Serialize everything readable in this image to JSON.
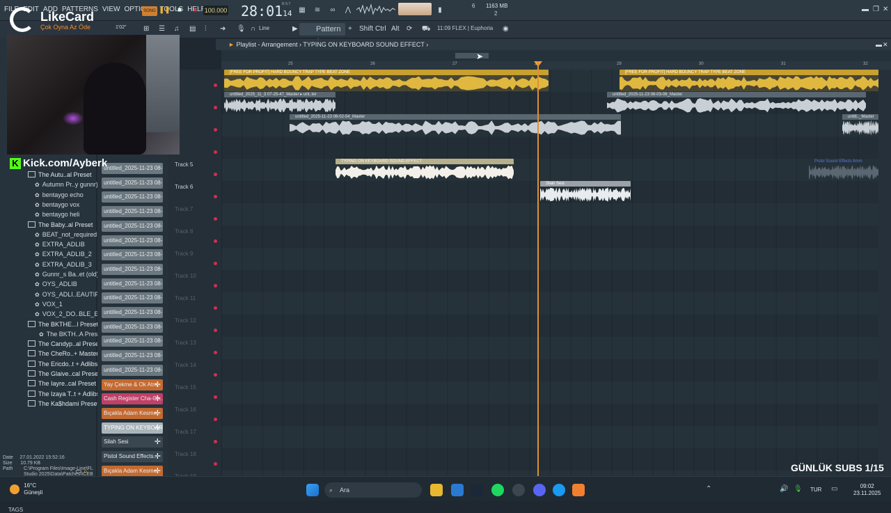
{
  "menu": [
    "FILE",
    "EDIT",
    "ADD",
    "PATTERNS",
    "VIEW",
    "OPTIONS",
    "TOOLS",
    "HELP"
  ],
  "transport": {
    "song_label": "SONG",
    "tempo": "100.000",
    "time": "28:01",
    "time_sub": "14",
    "time_sig": "B:S:T"
  },
  "monitor": {
    "cpu": "6",
    "memory": "1163 MB",
    "voices": "2"
  },
  "toolbar2": {
    "zoom": "1'02\"",
    "line_mode": "Line",
    "pattern": "Pattern 1",
    "shift": "Shift",
    "ctrl": "Ctrl",
    "alt": "Alt",
    "hint": "11:09  FLEX | Euphoria"
  },
  "browser": {
    "items": [
      {
        "label": "The Autu..al Preset",
        "kind": "folder"
      },
      {
        "label": "Autumn Pr..y gunnr)",
        "kind": "preset"
      },
      {
        "label": "bentaygo echo",
        "kind": "preset"
      },
      {
        "label": "bentaygo vox",
        "kind": "preset"
      },
      {
        "label": "bentaygo heli",
        "kind": "preset"
      },
      {
        "label": "The Baby..al Preset",
        "kind": "folder"
      },
      {
        "label": "BEAT_not_required",
        "kind": "preset"
      },
      {
        "label": "EXTRA_ADLIB",
        "kind": "preset"
      },
      {
        "label": "EXTRA_ADLIB_2",
        "kind": "preset"
      },
      {
        "label": "EXTRA_ADLIB_3",
        "kind": "preset"
      },
      {
        "label": "Gunnr_s Ba..et (old)",
        "kind": "preset"
      },
      {
        "label": "OYS_ADLIB",
        "kind": "preset"
      },
      {
        "label": "OYS_ADLI..EAUTIFUL",
        "kind": "preset"
      },
      {
        "label": "VOX_1",
        "kind": "preset"
      },
      {
        "label": "VOX_2_DO..BLE_EAR",
        "kind": "preset"
      },
      {
        "label": "The BKTHE...l Preset",
        "kind": "folder"
      },
      {
        "label": "The BKTH..A Preset",
        "kind": "preset"
      },
      {
        "label": "The Candyp..al Preset",
        "kind": "folder"
      },
      {
        "label": "The CheRo..+ Master",
        "kind": "folder"
      },
      {
        "label": "The Ericdo..t + Adlibs",
        "kind": "folder"
      },
      {
        "label": "The Glaive..cal Preset",
        "kind": "folder"
      },
      {
        "label": "The Iayre..cal Preset",
        "kind": "folder"
      },
      {
        "label": "The Izaya T..t + Adlibs",
        "kind": "folder"
      },
      {
        "label": "The Ka$hdami Preset",
        "kind": "folder"
      }
    ],
    "fileinfo": {
      "date_label": "Date",
      "date": "27.01.2022 15:52:16",
      "size_label": "Size",
      "size": "10.79 KB",
      "path_label": "Path",
      "path": "C:\\Program Files\\Image-Line\\FL Studio 2025\\Data\\Patches\\ICEBERG\\Gunnr Presets\\Vocal Presets\\The BKTHER-ULA Vocal Preset\\The BKTH..."
    },
    "tags_label": "TAGS"
  },
  "channels": [
    {
      "label": "untitled_2025-11-23 08-",
      "color": "gray"
    },
    {
      "label": "untitled_2025-11-23 08-",
      "color": "gray"
    },
    {
      "label": "untitled_2025-11-23 08-",
      "color": "gray"
    },
    {
      "label": "untitled_2025-11-23 08-",
      "color": "gray"
    },
    {
      "label": "untitled_2025-11-23 08-",
      "color": "gray"
    },
    {
      "label": "untitled_2025-11-23 08-",
      "color": "gray"
    },
    {
      "label": "untitled_2025-11-23 08-",
      "color": "gray"
    },
    {
      "label": "untitled_2025-11-23 08-",
      "color": "gray"
    },
    {
      "label": "untitled_2025-11-23 08-",
      "color": "gray"
    },
    {
      "label": "untitled_2025-11-23 08-",
      "color": "gray"
    },
    {
      "label": "untitled_2025-11-23 08-",
      "color": "gray"
    },
    {
      "label": "untitled_2025-11-23 08-",
      "color": "gray"
    },
    {
      "label": "untitled_2025-11-23 08-",
      "color": "gray"
    },
    {
      "label": "untitled_2025-11-23 08-",
      "color": "gray"
    },
    {
      "label": "untitled_2025-11-23 08-",
      "color": "gray"
    },
    {
      "label": "Yay Çekme & Ok Atm..",
      "color": "orange"
    },
    {
      "label": "Cash Register Cha-Ch..",
      "color": "pink"
    },
    {
      "label": "Bıçakla Adam Kesme..",
      "color": "orange"
    },
    {
      "label": "TYPING ON KEYBOAR..",
      "color": "light"
    },
    {
      "label": "Silah Sesi",
      "color": "dark"
    },
    {
      "label": "Pistol Sound Effects..",
      "color": "dark"
    },
    {
      "label": "Bıçakla Adam Kesme..",
      "color": "orange"
    }
  ],
  "playlist": {
    "title": "Playlist - Arrangement",
    "pattern": "TYPING ON KEYBOARD SOUND EFFECT",
    "bars": [
      "25",
      "26",
      "27",
      "28",
      "29",
      "30",
      "31",
      "32"
    ],
    "tracks": [
      "Track 5",
      "Track 6",
      "Track 7",
      "Track 8",
      "Track 9",
      "Track 10",
      "Track 11",
      "Track 12",
      "Track 13",
      "Track 14",
      "Track 15",
      "Track 16",
      "Track 17",
      "Track 18",
      "Track 19"
    ],
    "clips": {
      "beat_a": "[FREE FOR PROFIT] HARD BOUNCY TRAP TYPE BEAT ZONE",
      "beat_b": "[FREE FOR PROFIT] HARD BOUNCY TRAP TYPE BEAT ZONE",
      "vox_a": "untitled_2025_11_3 07-25-47_Master",
      "vox_a2": "unt..ter",
      "vox_b": "untitled_2025-11-23 08-03-06_Master",
      "vox_c": "untitled_2025-11-23 08-02-54_Master",
      "vox_d": "untitl.._Master",
      "typing": "TYPING ON KEYBOARD SOUND EFFECT",
      "silah": "Silah Sesi",
      "pistol": "Pistol Sound Effects 8mm"
    }
  },
  "overlay": {
    "brand": "LikeCard",
    "brand_tag": "Çok Oyna  Az Öde",
    "kick": "Kick.com/Ayberk",
    "subs": "GÜNLÜK SUBS 1/15"
  },
  "taskbar": {
    "temp": "16°C",
    "weather": "Güneşli",
    "search": "Ara",
    "lang": "TUR",
    "time": "09:02",
    "date": "23.11.2025"
  },
  "colors": {
    "accent": "#e09030",
    "clip_yellow": "#c8a030",
    "kick_green": "#53fc18"
  }
}
